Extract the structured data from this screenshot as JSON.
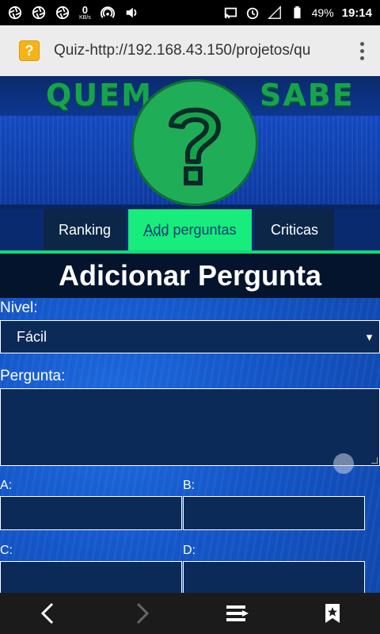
{
  "status_bar": {
    "speed_value": "0",
    "speed_unit": "KB/s",
    "battery": "49%",
    "time": "19:14",
    "icons": [
      "aperture-icon",
      "aperture-icon",
      "aperture-icon",
      "kbps-indicator",
      "hotspot-icon",
      "volume-icon",
      "cast-icon",
      "alarm-icon",
      "signal-icon",
      "battery-icon"
    ]
  },
  "browser": {
    "url": "Quiz-http://192.168.43.150/projetos/qu",
    "favicon": "?"
  },
  "banner": {
    "word_left": "QUEM",
    "word_right": "SABE",
    "center_symbol": "?"
  },
  "nav": {
    "tabs": [
      {
        "label": "Ranking",
        "active": false
      },
      {
        "label_underlined": "Add",
        "label_rest": " perguntas",
        "active": true
      },
      {
        "label": "Criticas",
        "active": false
      }
    ],
    "active_color": "#17ec7c"
  },
  "page": {
    "title": "Adicionar Pergunta"
  },
  "form": {
    "nivel_label": "Nivel:",
    "nivel_value": "Fácil",
    "pergunta_label": "Pergunta:",
    "pergunta_value": "",
    "option_a_label": "A:",
    "option_b_label": "B:",
    "option_c_label": "C:",
    "option_d_label": "D:"
  }
}
